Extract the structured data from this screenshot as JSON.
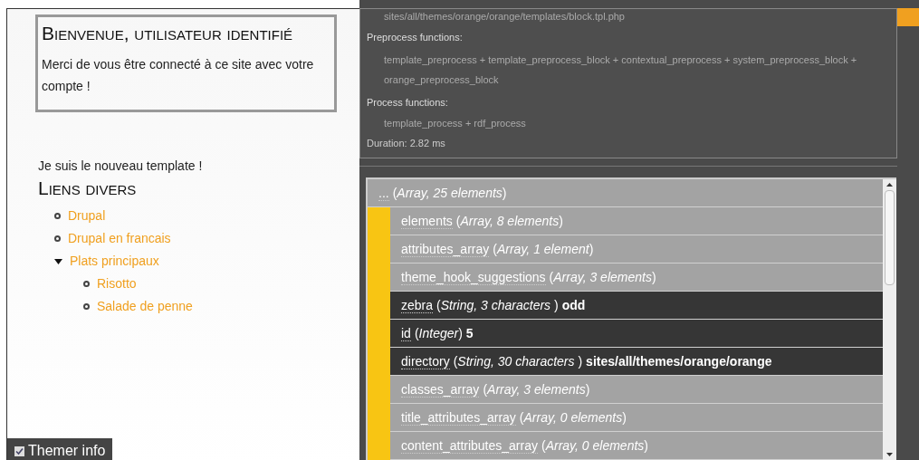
{
  "welcome_block": {
    "title": "Bienvenue, utilisateur identifié",
    "message": "Merci de vous être connecté à ce site avec votre compte !"
  },
  "template_note": "Je suis le nouveau template !",
  "links_block": {
    "title": "Liens divers",
    "items": [
      {
        "label": "Drupal",
        "expanded": false
      },
      {
        "label": "Drupal en francais",
        "expanded": false
      },
      {
        "label": "Plats principaux",
        "expanded": true,
        "children": [
          {
            "label": "Risotto",
            "expanded": false
          },
          {
            "label": "Salade de penne",
            "expanded": false
          }
        ]
      }
    ]
  },
  "themer_toggle": {
    "label": "Themer info",
    "checked": true
  },
  "themer_panel": {
    "template_file": "sites/all/themes/orange/orange/templates/block.tpl.php",
    "preprocess_label": "Preprocess functions:",
    "preprocess_functions": "template_preprocess + template_preprocess_block + contextual_preprocess + system_preprocess_block + orange_preprocess_block",
    "process_label": "Process functions:",
    "process_functions": "template_process + rdf_process",
    "duration": "Duration: 2.82 ms"
  },
  "variables": {
    "root": {
      "key": "...",
      "type": "(*Array, 25 elements*)"
    },
    "rows": [
      {
        "kind": "array",
        "key": "elements",
        "type": "(*Array, 8 elements*)"
      },
      {
        "kind": "array",
        "key": "attributes_array",
        "type": "(*Array, 1 element*)"
      },
      {
        "kind": "array",
        "key": "theme_hook_suggestions",
        "type": "(*Array, 3 elements*)"
      },
      {
        "kind": "scalar",
        "key": "zebra",
        "type": "(*String, 3 characters* )",
        "value": "odd"
      },
      {
        "kind": "scalar",
        "key": "id",
        "type": "(*Integer*)",
        "value": "5"
      },
      {
        "kind": "scalar",
        "key": "directory",
        "type": "(*String, 30 characters* )",
        "value": "sites/all/themes/orange/orange"
      },
      {
        "kind": "array",
        "key": "classes_array",
        "type": "(*Array, 3 elements*)"
      },
      {
        "kind": "array",
        "key": "title_attributes_array",
        "type": "(*Array, 0 elements*)"
      },
      {
        "kind": "array",
        "key": "content_attributes_array",
        "type": "(*Array, 0 elements*)"
      }
    ]
  }
}
